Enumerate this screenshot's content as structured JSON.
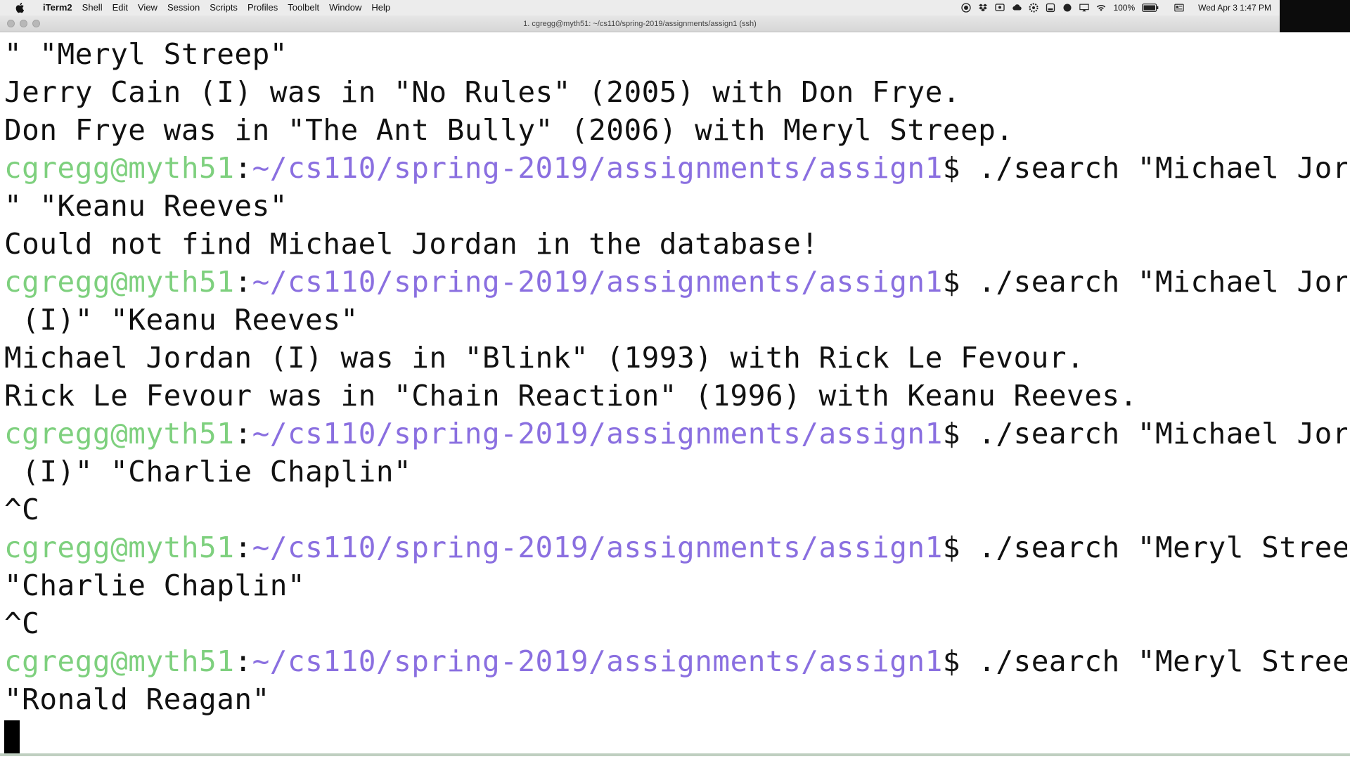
{
  "menubar": {
    "app_name": "iTerm2",
    "items": [
      "Shell",
      "Edit",
      "View",
      "Session",
      "Scripts",
      "Profiles",
      "Toolbelt",
      "Window",
      "Help"
    ],
    "battery": "100%",
    "datetime": "Wed Apr 3  1:47 PM"
  },
  "window": {
    "title": "1. cgregg@myth51: ~/cs110/spring-2019/assignments/assign1 (ssh)"
  },
  "terminal": {
    "user_host": "cgregg@myth51",
    "path": "~/cs110/spring-2019/assignments/assign1",
    "lines": [
      {
        "type": "output",
        "text": "\" \"Meryl Streep\""
      },
      {
        "type": "output",
        "text": "Jerry Cain (I) was in \"No Rules\" (2005) with Don Frye."
      },
      {
        "type": "output",
        "text": "Don Frye was in \"The Ant Bully\" (2006) with Meryl Streep."
      },
      {
        "type": "prompt",
        "command": " ./search \"Michael Jordan"
      },
      {
        "type": "output",
        "text": "\" \"Keanu Reeves\""
      },
      {
        "type": "output",
        "text": "Could not find Michael Jordan in the database!"
      },
      {
        "type": "prompt",
        "command": " ./search \"Michael Jordan"
      },
      {
        "type": "output",
        "text": " (I)\" \"Keanu Reeves\""
      },
      {
        "type": "output",
        "text": "Michael Jordan (I) was in \"Blink\" (1993) with Rick Le Fevour."
      },
      {
        "type": "output",
        "text": "Rick Le Fevour was in \"Chain Reaction\" (1996) with Keanu Reeves."
      },
      {
        "type": "prompt",
        "command": " ./search \"Michael Jordan"
      },
      {
        "type": "output",
        "text": " (I)\" \"Charlie Chaplin\""
      },
      {
        "type": "output",
        "text": "^C"
      },
      {
        "type": "prompt",
        "command": " ./search \"Meryl Streep\""
      },
      {
        "type": "output",
        "text": "\"Charlie Chaplin\""
      },
      {
        "type": "output",
        "text": "^C"
      },
      {
        "type": "prompt",
        "command": " ./search \"Meryl Streep\""
      },
      {
        "type": "output",
        "text": "\"Ronald Reagan\""
      },
      {
        "type": "cursor",
        "text": ""
      }
    ]
  },
  "colors": {
    "prompt_user": "#7ed07e",
    "prompt_path": "#8a6fe0",
    "text": "#111111",
    "background": "#ffffff"
  },
  "icons": [
    "apple-icon",
    "record-icon",
    "dropbox-icon",
    "screen-icon",
    "cloud-icon",
    "settings-icon",
    "drive-icon",
    "dot-icon",
    "airplay-icon",
    "wifi-icon",
    "battery-icon",
    "flag-icon"
  ]
}
